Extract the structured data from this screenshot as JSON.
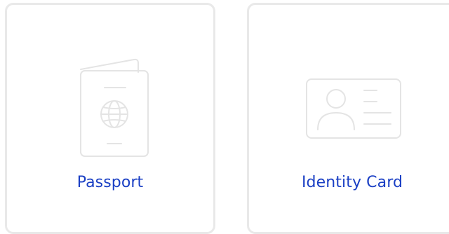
{
  "document_types": {
    "items": [
      {
        "label": "Passport",
        "icon": "passport-icon"
      },
      {
        "label": "Identity Card",
        "icon": "id-card-icon"
      }
    ]
  },
  "colors": {
    "label": "#1a3fc4",
    "card_border": "#e9e9e9",
    "icon_stroke": "#e4e4e4"
  }
}
